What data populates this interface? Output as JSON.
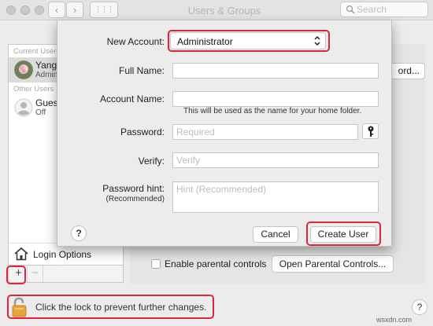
{
  "window": {
    "title": "Users & Groups",
    "back_glyph": "‹",
    "forward_glyph": "›",
    "grid_glyph": "⋮⋮⋮",
    "search_placeholder": "Search"
  },
  "sidebar": {
    "current_users_label": "Current User",
    "current_user": {
      "name": "Yang",
      "role": "Admin"
    },
    "other_users_label": "Other Users",
    "other_users": [
      {
        "name": "Gues",
        "status": "Off"
      }
    ],
    "login_options": "Login Options",
    "add_glyph": "+",
    "remove_glyph": "−"
  },
  "background": {
    "password_button": "ord...",
    "enable_parental": "Enable parental controls",
    "open_parental": "Open Parental Controls..."
  },
  "lock": {
    "text": "Click the lock to prevent further changes."
  },
  "help_glyph": "?",
  "watermark": "wsxdn.com",
  "sheet": {
    "new_account_label": "New Account:",
    "new_account_value": "Administrator",
    "full_name_label": "Full Name:",
    "full_name_value": "",
    "account_name_label": "Account Name:",
    "account_name_value": "",
    "account_name_hint": "This will be used as the name for your home folder.",
    "password_label": "Password:",
    "password_placeholder": "Required",
    "verify_label": "Verify:",
    "verify_placeholder": "Verify",
    "hint_label": "Password hint:",
    "hint_sublabel": "(Recommended)",
    "hint_placeholder": "Hint (Recommended)",
    "help": "?",
    "cancel_button": "Cancel",
    "create_button": "Create User"
  },
  "colors": {
    "highlight": "#e0243a",
    "lock_orange": "#e8a33a"
  },
  "icons": [
    "search-icon",
    "house-icon",
    "lock-icon",
    "key-icon",
    "chevron-updown-icon",
    "avatar-icon",
    "person-icon"
  ]
}
